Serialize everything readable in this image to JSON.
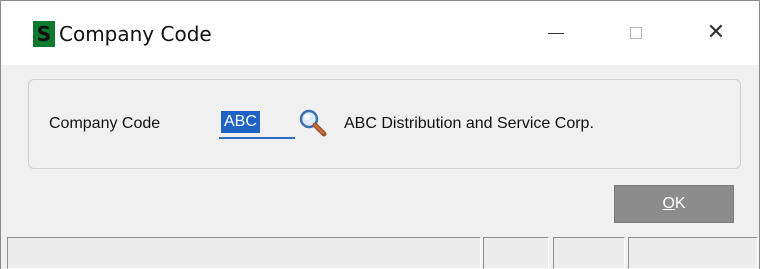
{
  "window": {
    "title": "Company Code",
    "app_icon_letter": "S",
    "icons": {
      "app": "sage-s-icon",
      "minimize": "minimize-icon",
      "maximize": "maximize-icon",
      "close": "close-icon",
      "lookup": "magnifier-icon"
    }
  },
  "form": {
    "field_label": "Company Code",
    "company_code_value": "ABC",
    "company_description": "ABC Distribution and Service Corp."
  },
  "buttons": {
    "ok_accel": "O",
    "ok_rest": "K"
  },
  "colors": {
    "app_icon_bg": "#0e7a2e",
    "selection_bg": "#1e63c4",
    "ok_button_bg": "#8c8c8c"
  }
}
